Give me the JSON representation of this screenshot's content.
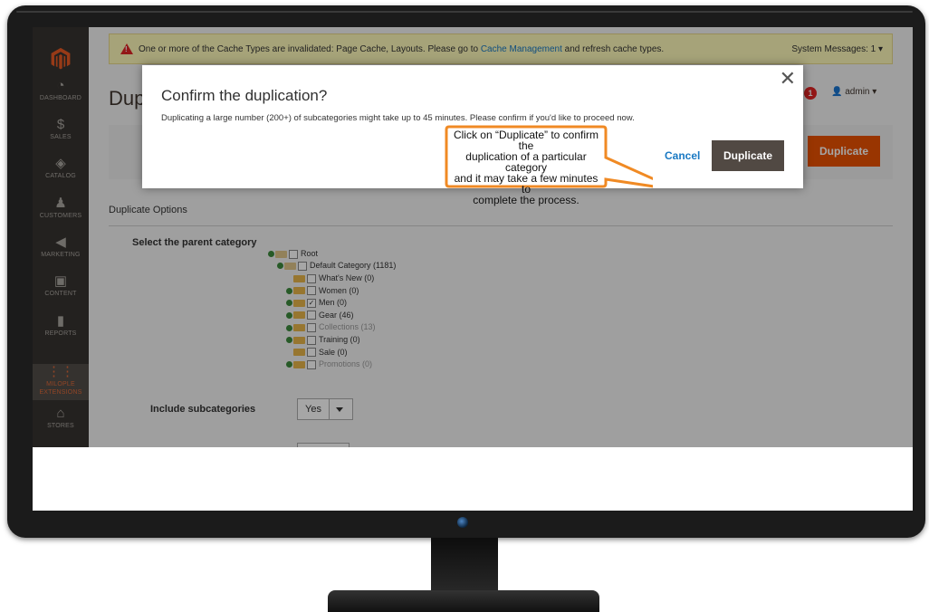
{
  "system_message": {
    "text_before": "One or more of the Cache Types are invalidated: Page Cache, Layouts. Please go to ",
    "link": "Cache Management",
    "text_after": " and refresh cache types.",
    "right": "System Messages: 1 ▾"
  },
  "sidebar": {
    "items": [
      {
        "label": "DASHBOARD",
        "icon": "◔",
        "icon_name": "dashboard-icon"
      },
      {
        "label": "SALES",
        "icon": "$",
        "icon_name": "sales-icon"
      },
      {
        "label": "CATALOG",
        "icon": "◈",
        "icon_name": "catalog-icon"
      },
      {
        "label": "CUSTOMERS",
        "icon": "♟",
        "icon_name": "customers-icon"
      },
      {
        "label": "MARKETING",
        "icon": "◀",
        "icon_name": "marketing-icon"
      },
      {
        "label": "CONTENT",
        "icon": "▣",
        "icon_name": "content-icon"
      },
      {
        "label": "REPORTS",
        "icon": "▮",
        "icon_name": "reports-icon"
      },
      {
        "label": "MILOPLE EXTENSIONS",
        "icon": "⋮⋮",
        "icon_name": "extensions-icon"
      },
      {
        "label": "STORES",
        "icon": "⌂",
        "icon_name": "stores-icon"
      }
    ]
  },
  "header": {
    "page_title": "Dup",
    "notifications_count": "1",
    "user": "admin ▾"
  },
  "action_bar": {
    "duplicate_label": "Duplicate"
  },
  "form": {
    "section_title": "Duplicate Options",
    "parent_label": "Select the parent category",
    "include_label": "Include subcategories",
    "include_value": "Yes"
  },
  "tree": {
    "root": "Root",
    "default": "Default Category (1181)",
    "children": [
      {
        "label": "What's New (0)",
        "checked": false,
        "muted": false
      },
      {
        "label": "Women (0)",
        "checked": false,
        "muted": false
      },
      {
        "label": "Men (0)",
        "checked": true,
        "muted": false
      },
      {
        "label": "Gear (46)",
        "checked": false,
        "muted": false
      },
      {
        "label": "Collections (13)",
        "checked": false,
        "muted": true
      },
      {
        "label": "Training (0)",
        "checked": false,
        "muted": false
      },
      {
        "label": "Sale (0)",
        "checked": false,
        "muted": false
      },
      {
        "label": "Promotions (0)",
        "checked": false,
        "muted": true
      }
    ]
  },
  "modal": {
    "title": "Confirm the duplication?",
    "text": "Duplicating a large number (200+) of subcategories might take up to 45 minutes. Please confirm if you'd like to proceed now.",
    "close": "✕",
    "cancel": "Cancel",
    "confirm": "Duplicate"
  },
  "callout": {
    "line1": "Click on “Duplicate” to confirm the",
    "line2": "duplication of a particular category",
    "line3": "and it may take a few minutes to",
    "line4": "complete the process."
  },
  "colors": {
    "accent": "#eb5202",
    "callout_border": "#f08a24",
    "link": "#1979c3"
  }
}
